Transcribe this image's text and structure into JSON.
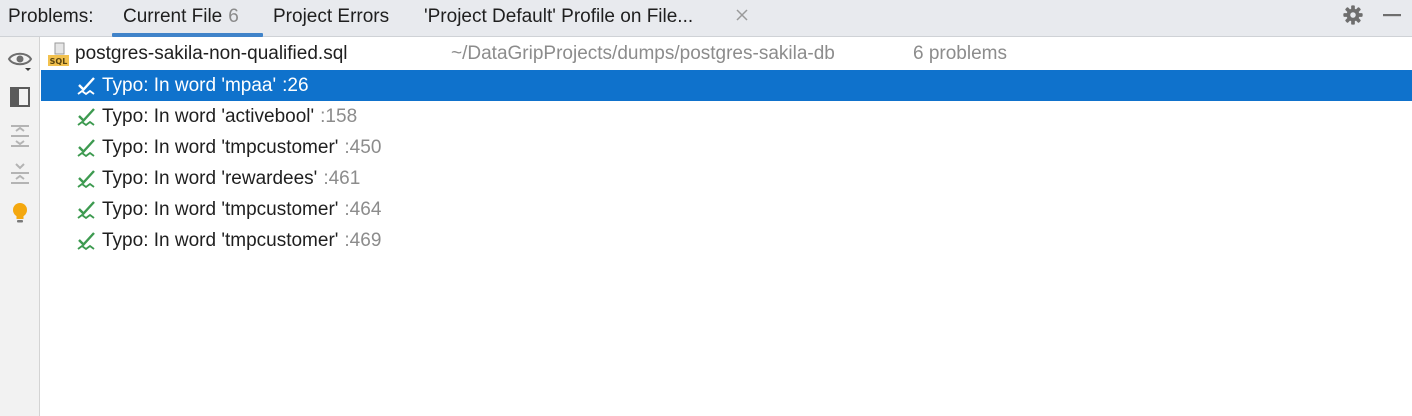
{
  "header": {
    "title": "Problems:",
    "tabs": [
      {
        "label": "Current File",
        "count": "6"
      },
      {
        "label": "Project Errors"
      },
      {
        "label": "'Project Default' Profile on File..."
      }
    ],
    "icons": [
      "gear-icon",
      "minimize-icon"
    ]
  },
  "toolbar": {
    "icons": [
      "eye-icon",
      "preview-panel-icon",
      "expand-all-icon",
      "collapse-all-icon",
      "lightbulb-icon"
    ]
  },
  "file": {
    "icon": "sql-file-icon",
    "name": "postgres-sakila-non-qualified.sql",
    "path": "~/DataGripProjects/dumps/postgres-sakila-db",
    "problems": "6 problems"
  },
  "problems": [
    {
      "text": "Typo: In word 'mpaa'",
      "line": ":26",
      "selected": true
    },
    {
      "text": "Typo: In word 'activebool'",
      "line": ":158",
      "selected": false
    },
    {
      "text": "Typo: In word 'tmpcustomer'",
      "line": ":450",
      "selected": false
    },
    {
      "text": "Typo: In word 'rewardees'",
      "line": ":461",
      "selected": false
    },
    {
      "text": "Typo: In word 'tmpcustomer'",
      "line": ":464",
      "selected": false
    },
    {
      "text": "Typo: In word 'tmpcustomer'",
      "line": ":469",
      "selected": false
    }
  ],
  "colors": {
    "selection": "#0f72cc",
    "tab_underline": "#4083c9",
    "typo_icon": "#3d9a50",
    "bulb": "#f4a80f"
  }
}
